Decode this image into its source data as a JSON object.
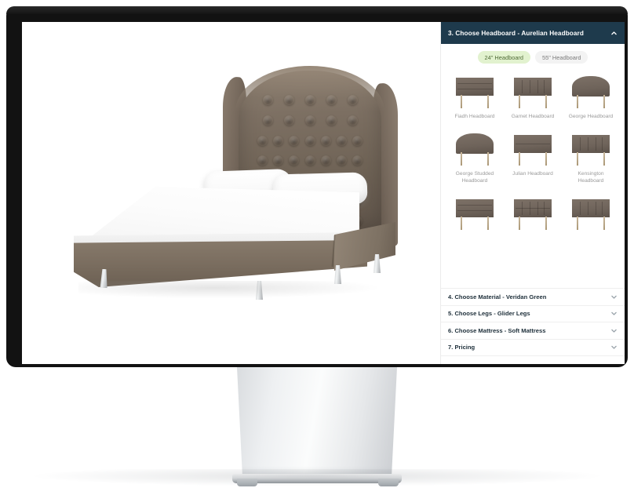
{
  "device": {
    "type": "desktop-monitor"
  },
  "preview": {
    "product": "tufted-winged-bed",
    "headboard_color": "#7d7063",
    "base_color": "#7b6e60",
    "mattress_color": "#ffffff",
    "leg_color": "#c9ccce"
  },
  "panel": {
    "header": {
      "title": "3. Choose Headboard - Aurelian Headboard",
      "expanded": true,
      "collapse_icon": "chevron-up-icon",
      "background": "#1e3a4c"
    },
    "size_toggle": {
      "options": [
        {
          "label": "24\" Headboard",
          "selected": true
        },
        {
          "label": "55\" Headboard",
          "selected": false
        }
      ],
      "selected_background": "#e2f2cf",
      "selected_text": "#4f6b36"
    },
    "headboards": [
      {
        "name": "Fiadh Headboard",
        "style": "horizontal-panel"
      },
      {
        "name": "Garnet Headboard",
        "style": "vertical-panel"
      },
      {
        "name": "George Headboard",
        "style": "arched"
      },
      {
        "name": "George Studded Headboard",
        "style": "arched"
      },
      {
        "name": "Julian Headboard",
        "style": "two-panel"
      },
      {
        "name": "Kensington Headboard",
        "style": "vertical-panel"
      },
      {
        "name": "",
        "style": "horizontal-panel"
      },
      {
        "name": "",
        "style": "grid-tufted"
      },
      {
        "name": "",
        "style": "vertical-panel"
      }
    ],
    "accordion": [
      {
        "label": "4. Choose Material - Veridan Green",
        "icon": "chevron-down-icon"
      },
      {
        "label": "5. Choose Legs - Glider Legs",
        "icon": "chevron-down-icon"
      },
      {
        "label": "6. Choose Mattress - Soft Mattress",
        "icon": "chevron-down-icon"
      },
      {
        "label": "7. Pricing",
        "icon": "chevron-down-icon"
      }
    ]
  }
}
